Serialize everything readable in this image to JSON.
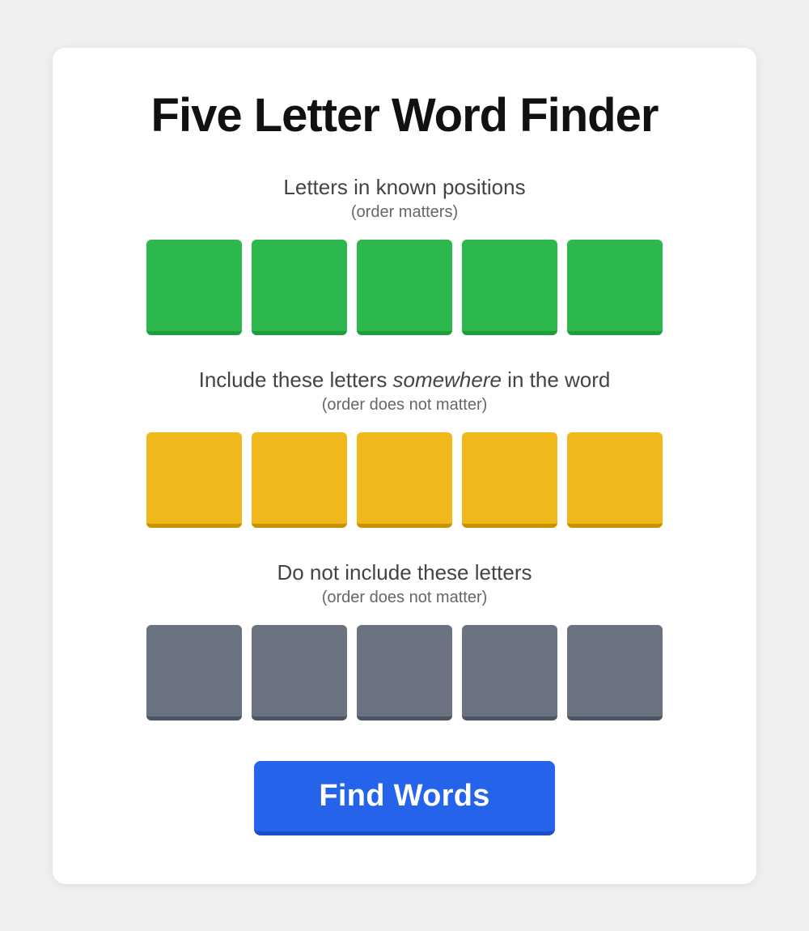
{
  "page": {
    "title": "Five Letter Word Finder",
    "background_color": "#f0f0f0"
  },
  "sections": {
    "known_positions": {
      "title": "Letters in known positions",
      "subtitle": "(order matters)",
      "tile_color": "green",
      "tiles": [
        {
          "id": 1,
          "value": "",
          "placeholder": ""
        },
        {
          "id": 2,
          "value": "",
          "placeholder": ""
        },
        {
          "id": 3,
          "value": "",
          "placeholder": ""
        },
        {
          "id": 4,
          "value": "",
          "placeholder": ""
        },
        {
          "id": 5,
          "value": "",
          "placeholder": ""
        }
      ]
    },
    "somewhere": {
      "title_prefix": "Include these letters ",
      "title_italic": "somewhere",
      "title_suffix": " in the word",
      "subtitle": "(order does not matter)",
      "tile_color": "yellow",
      "tiles": [
        {
          "id": 1,
          "value": "",
          "placeholder": ""
        },
        {
          "id": 2,
          "value": "",
          "placeholder": ""
        },
        {
          "id": 3,
          "value": "",
          "placeholder": ""
        },
        {
          "id": 4,
          "value": "",
          "placeholder": ""
        },
        {
          "id": 5,
          "value": "",
          "placeholder": ""
        }
      ]
    },
    "exclude": {
      "title": "Do not include these letters",
      "subtitle": "(order does not matter)",
      "tile_color": "gray",
      "tiles": [
        {
          "id": 1,
          "value": "",
          "placeholder": ""
        },
        {
          "id": 2,
          "value": "",
          "placeholder": ""
        },
        {
          "id": 3,
          "value": "",
          "placeholder": ""
        },
        {
          "id": 4,
          "value": "",
          "placeholder": ""
        },
        {
          "id": 5,
          "value": "",
          "placeholder": ""
        }
      ]
    }
  },
  "button": {
    "label": "Find Words",
    "color": "#2563eb"
  }
}
